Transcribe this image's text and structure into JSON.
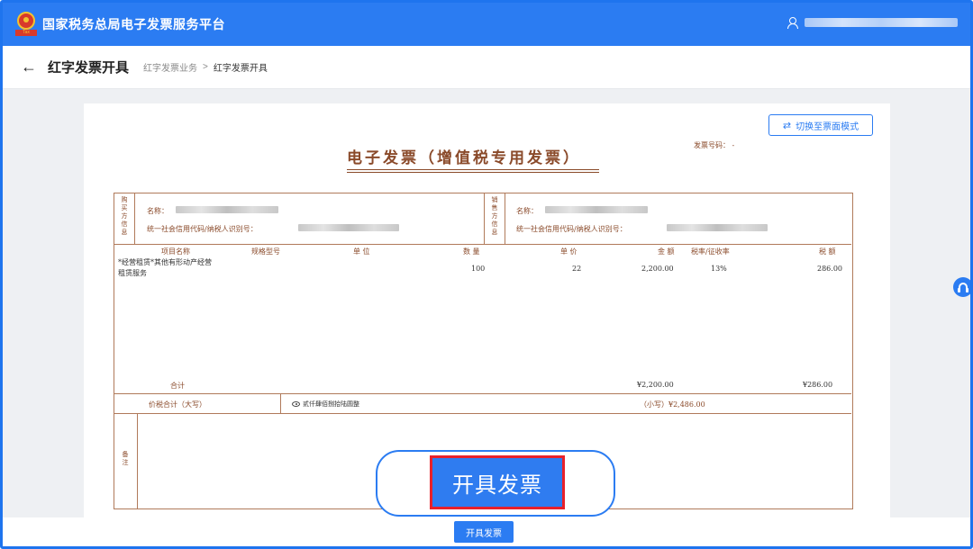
{
  "header": {
    "app_title": "国家税务总局电子发票服务平台",
    "emblem_text": "Tax"
  },
  "subheader": {
    "back_icon": "arrow-left-icon",
    "page_title": "红字发票开具",
    "breadcrumb": [
      "红字发票业务",
      "红字发票开具"
    ],
    "separator": ">"
  },
  "toolbar": {
    "switch_label": "切换至票面模式",
    "switch_icon": "swap-icon"
  },
  "invoice": {
    "title": "电子发票（增值税专用发票）",
    "number_label": "发票号码：",
    "buyer": {
      "section_label": "购买方信息",
      "name_label": "名称：",
      "tax_id_label": "统一社会信用代码/纳税人识别号："
    },
    "seller": {
      "section_label": "销售方信息",
      "name_label": "名称：",
      "tax_id_label": "统一社会信用代码/纳税人识别号："
    },
    "columns": [
      "项目名称",
      "规格型号",
      "单 位",
      "数 量",
      "单 价",
      "金 额",
      "税率/征收率",
      "税 额"
    ],
    "items": [
      {
        "name_line1": "*经营租赁*其他有形动产经营",
        "name_line2": "租赁服务",
        "spec": "",
        "unit": "",
        "quantity": "100",
        "price": "22",
        "amount": "2,200.00",
        "tax_rate": "13%",
        "tax": "286.00"
      }
    ],
    "subtotal_label": "合计",
    "subtotal_amount": "¥2,200.00",
    "subtotal_tax": "¥286.00",
    "total_label": "价税合计（大写）",
    "total_uppercase": "贰仟肆佰捌拾陆圆整",
    "total_small": "（小写）¥2,486.00",
    "remarks_label": "备注"
  },
  "callout": {
    "button_label": "开具发票"
  },
  "footer": {
    "issue_button_label": "开具发票"
  },
  "side_float": {
    "icon": "headset-icon"
  },
  "colors": {
    "brand_blue": "#2b7cf2",
    "invoice_brown": "#8a4a2a",
    "highlight_red": "#e8212b"
  }
}
